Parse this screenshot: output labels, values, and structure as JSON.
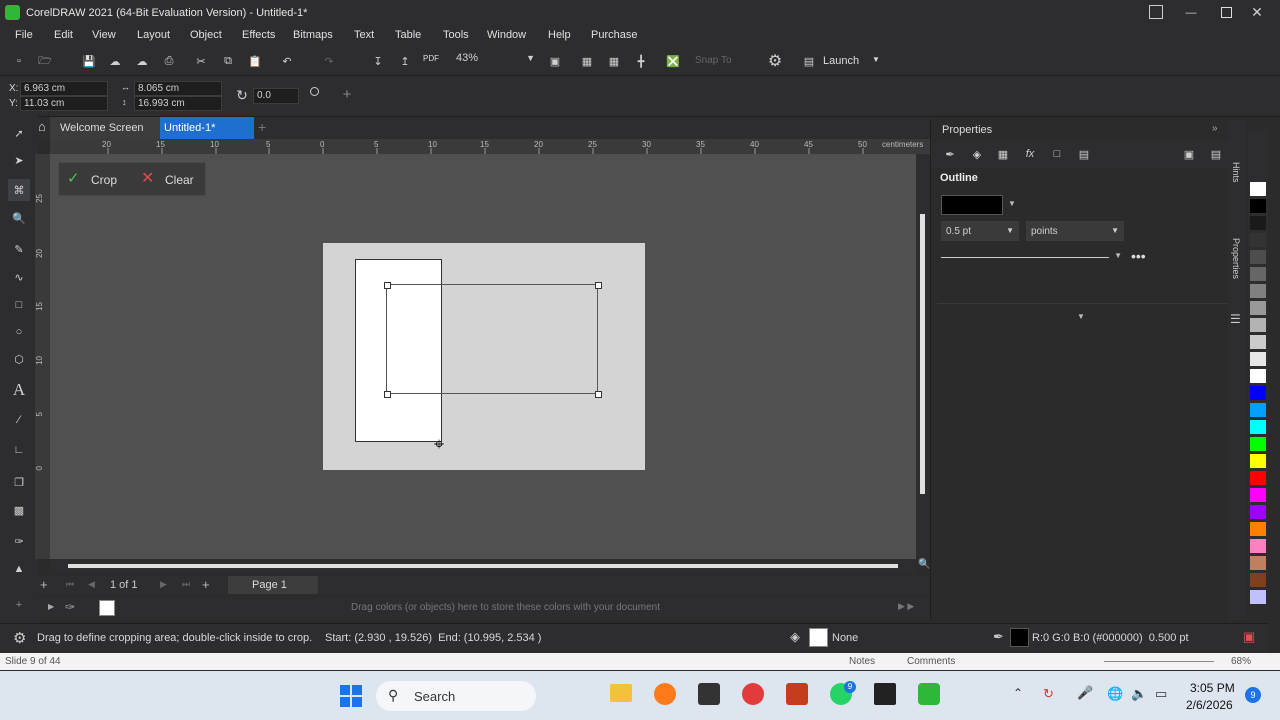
{
  "window": {
    "title": "CorelDRAW 2021 (64-Bit Evaluation Version) - Untitled-1*"
  },
  "menu": [
    "File",
    "Edit",
    "View",
    "Layout",
    "Object",
    "Effects",
    "Bitmaps",
    "Text",
    "Table",
    "Tools",
    "Window",
    "Help",
    "Purchase"
  ],
  "toolbar": {
    "zoom": "43%",
    "snap_to": "Snap To",
    "launch": "Launch",
    "pdf": "PDF"
  },
  "propbar": {
    "x": "6.963 cm",
    "y": "11.03 cm",
    "w": "8.065 cm",
    "h": "16.993 cm",
    "angle": "0.0",
    "x_label": "X:",
    "y_label": "Y:"
  },
  "tabs": {
    "welcome": "Welcome Screen",
    "doc": "Untitled-1*"
  },
  "ruler": {
    "h_ticks": [
      "20",
      "15",
      "10",
      "5",
      "0",
      "5",
      "10",
      "15",
      "20",
      "25",
      "30",
      "35",
      "40",
      "45",
      "50"
    ],
    "unit": "centimeters",
    "v_ticks": [
      "25",
      "20",
      "15",
      "10",
      "5",
      "0"
    ]
  },
  "crop_toolbar": {
    "crop": "Crop",
    "clear": "Clear"
  },
  "pagebar": {
    "count": "1 of 1",
    "page": "Page 1"
  },
  "docpalette": {
    "hint": "Drag colors (or objects) here to store these colors with your document"
  },
  "properties": {
    "title": "Properties",
    "section": "Outline",
    "width": "0.5 pt",
    "units": "points",
    "side_tabs": [
      "Hints",
      "Properties"
    ]
  },
  "status": {
    "hint": "Drag to define cropping area; double-click inside to crop.",
    "coords": "Start: (2.930 , 19.526)  End: (10.995, 2.534 )",
    "fill": "None",
    "outline": "R:0 G:0 B:0 (#000000)  0.500 pt"
  },
  "slidebar": {
    "slide": "Slide 9 of 44",
    "notes": "Notes",
    "comments": "Comments",
    "zoom": "68%"
  },
  "taskbar": {
    "search": "Search",
    "time": "3:05 PM",
    "date": "2/6/2026",
    "notif": "9",
    "whatsapp_badge": "9"
  },
  "palette_colors": [
    "#ffffff",
    "#000000",
    "#1a1a1a",
    "#333333",
    "#4d4d4d",
    "#666666",
    "#808080",
    "#999999",
    "#b3b3b3",
    "#cccccc",
    "#e6e6e6",
    "#ffffff",
    "#0000ff",
    "#00a0ff",
    "#00ffff",
    "#00ff00",
    "#ffff00",
    "#ff0000",
    "#ff00ff",
    "#a000ff",
    "#ff8000",
    "#ff80c0",
    "#c08060",
    "#804020",
    "#c0c0ff"
  ]
}
